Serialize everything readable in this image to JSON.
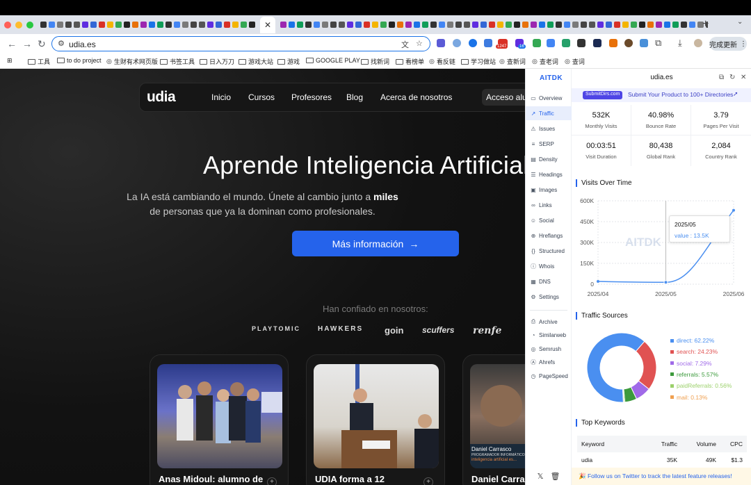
{
  "browser": {
    "address": "udia.es",
    "tab_count_badge": "1247",
    "ext_badge": "16",
    "update_label": "完成更新",
    "bookmarks": [
      "工具",
      "to do project",
      "生财有术网页版",
      "书签工具",
      "日入万刀",
      "游戏大站",
      "游戏",
      "GOOGLE PLAY",
      "找新词",
      "看榜单",
      "看反链",
      "学习做站",
      "查新词",
      "查老词",
      "查词"
    ]
  },
  "site": {
    "logo": "udia",
    "nav": [
      "Inicio",
      "Cursos",
      "Profesores",
      "Blog",
      "Acerca de nosotros"
    ],
    "login": "Acceso alumnos",
    "headline": "Aprende Inteligencia Artificial",
    "subtitle_a": "La IA está cambiando el mundo. Únete al cambio junto a ",
    "subtitle_bold": "miles",
    "subtitle_b": "de personas que ya la dominan como profesionales.",
    "cta": "Más información",
    "trust": "Han confiado en nosotros:",
    "brands": [
      "PLAYTOMIC",
      "HAWKERS",
      "goin",
      "scuffers",
      "renfe"
    ],
    "cards": [
      {
        "title": "Anas Midoul: alumno de"
      },
      {
        "title": "UDIA forma a 12"
      },
      {
        "title": "Daniel Carrasco"
      }
    ],
    "card3_caption_name": "Daniel Carrasco",
    "card3_caption_role": "PROGRAMADOR INFORMÁTICO",
    "card3_caption_line": "inteligencia artificial es..."
  },
  "panel": {
    "brand": "AITDK",
    "domain": "udia.es",
    "menu": [
      "Overview",
      "Traffic",
      "Issues",
      "SERP",
      "Density",
      "Headings",
      "Images",
      "Links",
      "Social",
      "Hreflangs",
      "Structured",
      "Whois",
      "DNS",
      "Settings"
    ],
    "menu_icons": [
      "overview-icon",
      "traffic-icon",
      "issues-icon",
      "serp-icon",
      "density-icon",
      "headings-icon",
      "images-icon",
      "links-icon",
      "social-icon",
      "hreflangs-icon",
      "structured-icon",
      "whois-icon",
      "dns-icon",
      "settings-icon"
    ],
    "tools": [
      "Archive",
      "Similarweb",
      "Semrush",
      "Ahrefs",
      "PageSpeed"
    ],
    "banner_badge": "SubmitDirs.com",
    "banner_text": "Submit Your Product to 100+ Directories",
    "stats": [
      {
        "value": "532K",
        "label": "Monthly Visits"
      },
      {
        "value": "40.98%",
        "label": "Bounce Rate"
      },
      {
        "value": "3.79",
        "label": "Pages Per Visit"
      },
      {
        "value": "00:03:51",
        "label": "Visit Duration"
      },
      {
        "value": "80,438",
        "label": "Global Rank"
      },
      {
        "value": "2,084",
        "label": "Country Rank"
      }
    ],
    "visits_title": "Visits Over Time",
    "tooltip_date": "2025/05",
    "tooltip_value": "value : 13.5K",
    "watermark": "AITDK",
    "sources_title": "Traffic Sources",
    "keywords_title": "Top Keywords",
    "kw_headers": [
      "Keyword",
      "Traffic",
      "Volume",
      "CPC"
    ],
    "kw_rows": [
      [
        "udia",
        "35K",
        "49K",
        "$1.3"
      ]
    ],
    "footer": "🎉 Follow us on Twitter to track the latest feature releases!",
    "colors": {
      "accent": "#2563eb",
      "direct": "#4a8ff0",
      "search": "#e05252",
      "social": "#a06ae8",
      "referrals": "#3c9a3c",
      "paidReferrals": "#9bd06a",
      "mail": "#f0a050"
    }
  },
  "chart_data": [
    {
      "type": "line",
      "title": "Visits Over Time",
      "x": [
        "2025/04",
        "2025/05",
        "2025/06"
      ],
      "series": [
        {
          "values": [
            20000,
            13500,
            532000
          ]
        }
      ],
      "ylim": [
        0,
        600000
      ],
      "yticks": [
        "0",
        "150K",
        "300K",
        "450K",
        "600K"
      ],
      "grid": true
    },
    {
      "type": "pie",
      "title": "Traffic Sources",
      "categories": [
        "direct",
        "search",
        "social",
        "referrals",
        "paidReferrals",
        "mail"
      ],
      "values": [
        62.22,
        24.23,
        7.29,
        5.57,
        0.56,
        0.13
      ],
      "labels": [
        "direct: 62.22%",
        "search: 24.23%",
        "social: 7.29%",
        "referrals: 5.57%",
        "paidReferrals: 0.56%",
        "mail: 0.13%"
      ],
      "legend": "right"
    }
  ]
}
